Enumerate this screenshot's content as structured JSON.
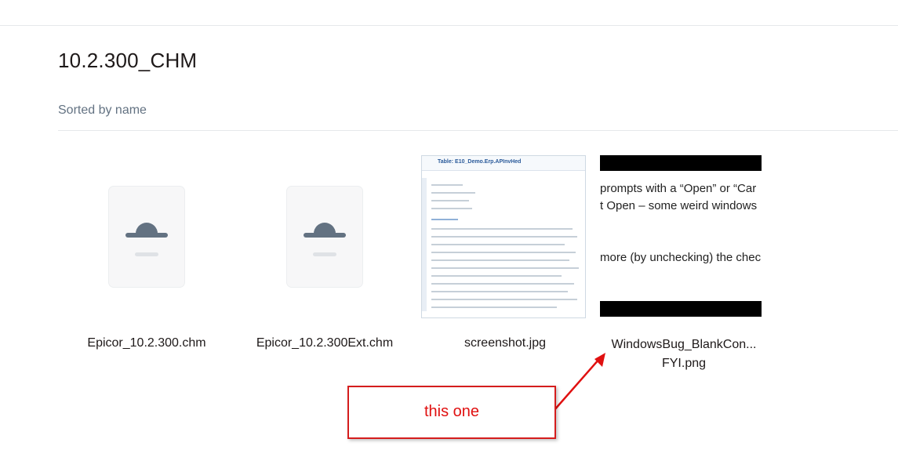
{
  "folder": {
    "title": "10.2.300_CHM",
    "sort_label": "Sorted by name"
  },
  "files": [
    {
      "name": "Epicor_10.2.300.chm",
      "icon": "lock-icon"
    },
    {
      "name": "Epicor_10.2.300Ext.chm",
      "icon": "lock-icon"
    },
    {
      "name": "screenshot.jpg",
      "preview_title": "Table: E10_Demo.Erp.APInvHed"
    },
    {
      "name_line1": "WindowsBug_BlankCon...",
      "name_line2": "FYI.png",
      "preview_lines": [
        "prompts with a “Open” or “Car",
        "t Open – some weird windows",
        "more (by unchecking) the chec"
      ]
    }
  ],
  "annotation": {
    "text": "this one",
    "color": "#e01010"
  }
}
